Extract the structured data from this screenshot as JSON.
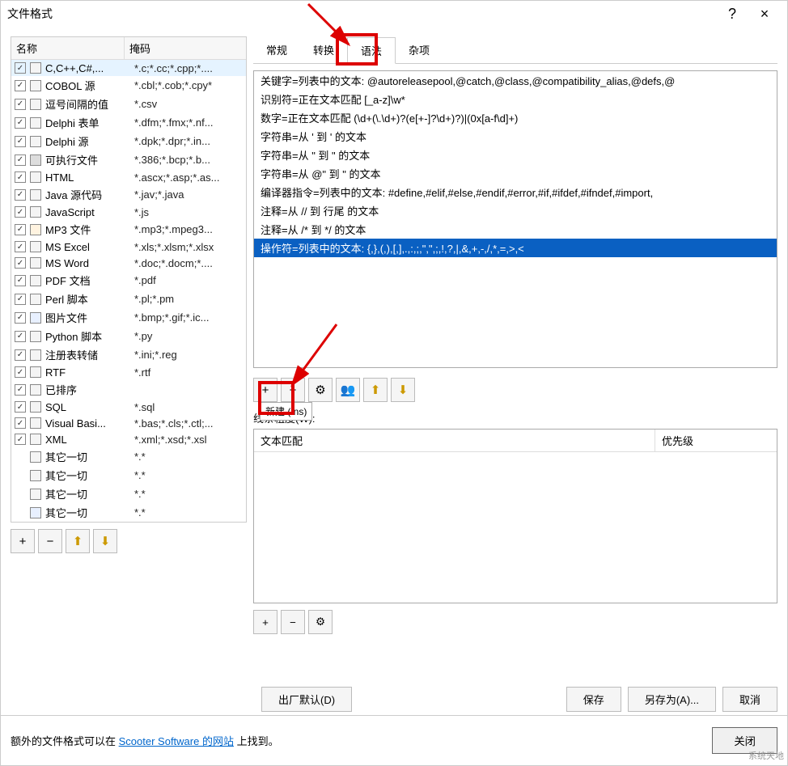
{
  "window": {
    "title": "文件格式",
    "help": "?",
    "close": "×"
  },
  "leftHeader": {
    "name": "名称",
    "mask": "掩码"
  },
  "fileFormats": [
    {
      "checked": true,
      "sel": true,
      "name": "C,C++,C#,...",
      "mask": "*.c;*.cc;*.cpp;*...."
    },
    {
      "checked": true,
      "name": "COBOL 源",
      "mask": "*.cbl;*.cob;*.cpy*"
    },
    {
      "checked": true,
      "name": "逗号间隔的值",
      "mask": "*.csv"
    },
    {
      "checked": true,
      "name": "Delphi 表单",
      "mask": "*.dfm;*.fmx;*.nf..."
    },
    {
      "checked": true,
      "name": "Delphi 源",
      "mask": "*.dpk;*.dpr;*.in..."
    },
    {
      "checked": true,
      "icon": "exe",
      "name": "可执行文件",
      "mask": "*.386;*.bcp;*.b..."
    },
    {
      "checked": true,
      "name": "HTML",
      "mask": "*.ascx;*.asp;*.as..."
    },
    {
      "checked": true,
      "name": "Java 源代码",
      "mask": "*.jav;*.java"
    },
    {
      "checked": true,
      "name": "JavaScript",
      "mask": "*.js"
    },
    {
      "checked": true,
      "icon": "mus",
      "name": "MP3 文件",
      "mask": "*.mp3;*.mpeg3..."
    },
    {
      "checked": true,
      "name": "MS Excel",
      "mask": "*.xls;*.xlsm;*.xlsx"
    },
    {
      "checked": true,
      "name": "MS Word",
      "mask": "*.doc;*.docm;*...."
    },
    {
      "checked": true,
      "name": "PDF 文档",
      "mask": "*.pdf"
    },
    {
      "checked": true,
      "name": "Perl 脚本",
      "mask": "*.pl;*.pm"
    },
    {
      "checked": true,
      "icon": "img",
      "name": "图片文件",
      "mask": "*.bmp;*.gif;*.ic..."
    },
    {
      "checked": true,
      "name": "Python 脚本",
      "mask": "*.py"
    },
    {
      "checked": true,
      "name": "注册表转储",
      "mask": "*.ini;*.reg"
    },
    {
      "checked": true,
      "name": "RTF",
      "mask": "*.rtf"
    },
    {
      "checked": true,
      "name": "已排序",
      "mask": ""
    },
    {
      "checked": true,
      "name": "SQL",
      "mask": "*.sql"
    },
    {
      "checked": true,
      "name": "Visual Basi...",
      "mask": "*.bas;*.cls;*.ctl;..."
    },
    {
      "checked": true,
      "name": "XML",
      "mask": "*.xml;*.xsd;*.xsl"
    },
    {
      "indent": true,
      "name": "其它一切",
      "mask": "*.*"
    },
    {
      "indent": true,
      "name": "其它一切",
      "mask": "*.*"
    },
    {
      "indent": true,
      "name": "其它一切",
      "mask": "*.*"
    },
    {
      "indent": true,
      "icon": "img",
      "name": "其它一切",
      "mask": "*.*"
    }
  ],
  "leftButtons": {
    "add": "+",
    "remove": "−",
    "up": "⬆",
    "down": "⬇"
  },
  "tabs": {
    "general": "常规",
    "convert": "转换",
    "syntax": "语法",
    "misc": "杂项"
  },
  "rules": [
    "关键字=列表中的文本: @autoreleasepool,@catch,@class,@compatibility_alias,@defs,@",
    "识别符=正在文本匹配 [_a-z]\\w*",
    "数字=正在文本匹配 (\\d+(\\.\\d+)?(e[+-]?\\d+)?)|(0x[a-f\\d]+)",
    "字符串=从 ' 到 ' 的文本",
    "字符串=从 \" 到 \" 的文本",
    "字符串=从 @\" 到 \" 的文本",
    "编译器指令=列表中的文本: #define,#elif,#else,#endif,#error,#if,#ifdef,#ifndef,#import,",
    "注释=从 // 到 行尾 的文本",
    "注释=从 /* 到 */ 的文本"
  ],
  "rulesSelected": "操作符=列表中的文本: {,},(,),[,],.,:,;,\",\",;,!,?,|,&,+,-,/,*,=,>,<",
  "ruleButtons": {
    "add": "+",
    "remove": "−",
    "gear": "⚙",
    "group": "👥",
    "up": "⬆",
    "down": "⬇"
  },
  "tooltip": "新建 (Ins)",
  "sectionLabel": "线条粗度(W):",
  "subHeader": {
    "c1": "文本匹配",
    "c2": "优先级"
  },
  "subButtons": {
    "add": "+",
    "remove": "−",
    "gear": "⚙"
  },
  "footer": {
    "defaults": "出厂默认(D)",
    "save": "保存",
    "saveAs": "另存为(A)...",
    "cancel": "取消"
  },
  "bottom": {
    "pre": "额外的文件格式可以在 ",
    "link": "Scooter Software 的网站",
    "post": " 上找到。",
    "close": "关闭"
  },
  "watermark": "系统天地"
}
